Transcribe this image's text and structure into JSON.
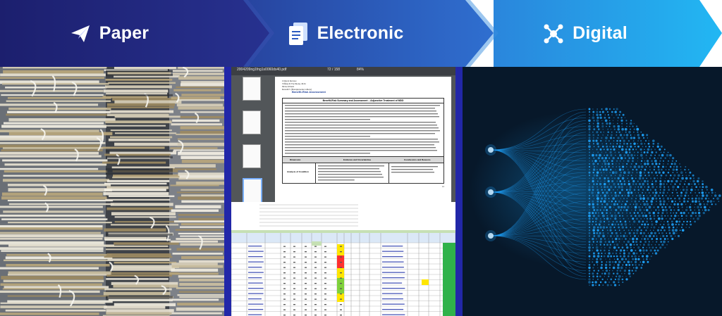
{
  "stages": [
    {
      "label": "Paper",
      "icon": "paper-plane-icon",
      "color": "#24247a"
    },
    {
      "label": "Electronic",
      "icon": "document-stack-icon",
      "color": "#2b59c0"
    },
    {
      "label": "Digital",
      "icon": "network-nodes-icon",
      "color": "#1b9fe8"
    }
  ],
  "electronic": {
    "filename": "2004209ng1fng1s0060ds40.pdf",
    "page": "72 / 158",
    "zoom": "84%",
    "doc_lines": [
      "Clinical Review",
      "Tiffany R Farchione, M.D.",
      "NDA 205422",
      "Rexulti® (Brexpiprazole tablets)"
    ],
    "section_title": "Benefit-Risk Assessment",
    "table_title": "Benefit-Risk Summary and Assessment – Adjunctive Treatment of MDD",
    "table_headers": [
      "Dimension",
      "Evidence and Uncertainties",
      "Conclusions and Reasons"
    ],
    "row_label": "Analysis of Condition",
    "page_number": "12"
  },
  "colors": {
    "paper_bg": "#5b6068",
    "electronic_bg": "#2b2f9b",
    "digital_bg": "#081a2c",
    "digital_dots": "#1ea5ff"
  }
}
